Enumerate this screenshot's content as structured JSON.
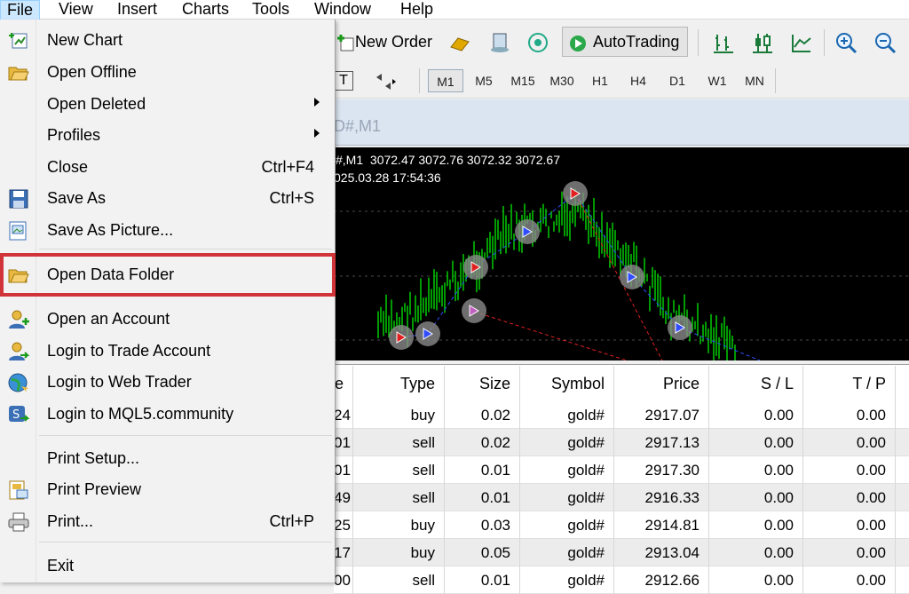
{
  "menubar": {
    "items": [
      "File",
      "View",
      "Insert",
      "Charts",
      "Tools",
      "Window",
      "Help"
    ]
  },
  "toolbar": {
    "new_order": "New Order",
    "autotrading": "AutoTrading",
    "text_tool": "T"
  },
  "timeframes": [
    "M1",
    "M5",
    "M15",
    "M30",
    "H1",
    "H4",
    "D1",
    "W1",
    "MN"
  ],
  "chart": {
    "tab_fragment": "D#,M1",
    "ohlc": "#,M1  3072.47 3072.76 3072.32 3072.67",
    "date": "025.03.28 17:54:36"
  },
  "file_menu": {
    "items": [
      {
        "label": "New Chart",
        "shortcut": "",
        "icon": "new-chart-icon"
      },
      {
        "label": "Open Offline",
        "shortcut": "",
        "icon": "open-folder-icon"
      },
      {
        "label": "Open Deleted",
        "shortcut": "",
        "submenu": true
      },
      {
        "label": "Profiles",
        "shortcut": "",
        "submenu": true
      },
      {
        "label": "Close",
        "shortcut": "Ctrl+F4"
      },
      {
        "label": "Save As",
        "shortcut": "Ctrl+S",
        "icon": "save-icon"
      },
      {
        "label": "Save As Picture...",
        "shortcut": "",
        "icon": "save-picture-icon"
      },
      {
        "label": "Open Data Folder",
        "shortcut": "",
        "icon": "folder-icon",
        "highlighted": true
      },
      {
        "label": "Open an Account",
        "shortcut": "",
        "icon": "account-icon"
      },
      {
        "label": "Login to Trade Account",
        "shortcut": "",
        "icon": "login-icon"
      },
      {
        "label": "Login to Web Trader",
        "shortcut": "",
        "icon": "web-icon"
      },
      {
        "label": "Login to MQL5.community",
        "shortcut": "",
        "icon": "mql5-icon"
      },
      {
        "label": "Print Setup...",
        "shortcut": ""
      },
      {
        "label": "Print Preview",
        "shortcut": "",
        "icon": "print-preview-icon"
      },
      {
        "label": "Print...",
        "shortcut": "Ctrl+P",
        "icon": "printer-icon"
      },
      {
        "label": "Exit",
        "shortcut": ""
      }
    ]
  },
  "trade_table": {
    "headers": [
      "e",
      "Type",
      "Size",
      "Symbol",
      "Price",
      "S / L",
      "T / P"
    ],
    "rows": [
      [
        "24",
        "buy",
        "0.02",
        "gold#",
        "2917.07",
        "0.00",
        "0.00"
      ],
      [
        "01",
        "sell",
        "0.02",
        "gold#",
        "2917.13",
        "0.00",
        "0.00"
      ],
      [
        "01",
        "sell",
        "0.01",
        "gold#",
        "2917.30",
        "0.00",
        "0.00"
      ],
      [
        "49",
        "sell",
        "0.01",
        "gold#",
        "2916.33",
        "0.00",
        "0.00"
      ],
      [
        "25",
        "buy",
        "0.03",
        "gold#",
        "2914.81",
        "0.00",
        "0.00"
      ],
      [
        "17",
        "buy",
        "0.05",
        "gold#",
        "2913.04",
        "0.00",
        "0.00"
      ],
      [
        "00",
        "sell",
        "0.01",
        "gold#",
        "2912.66",
        "0.00",
        "0.00"
      ]
    ]
  },
  "colors": {
    "highlight_border": "#d13438",
    "candles": "#00cc00",
    "chart_bg": "#000000",
    "menu_hover": "#cce8ff"
  }
}
